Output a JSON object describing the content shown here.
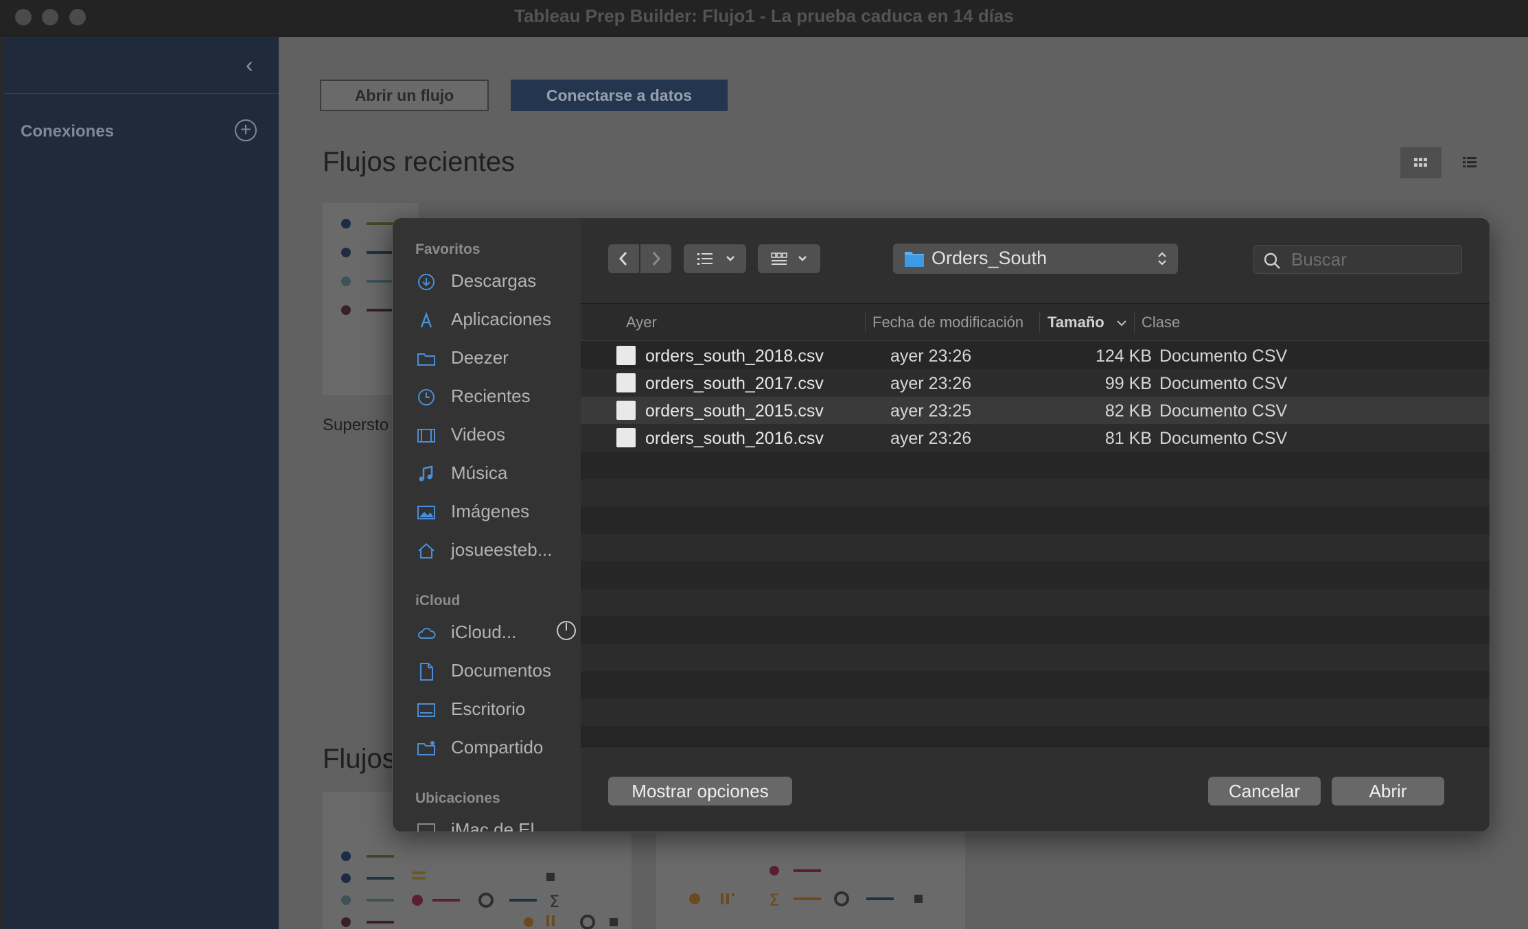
{
  "window": {
    "title": "Tableau Prep Builder: Flujo1 - La prueba caduca en 14 días"
  },
  "left_panel": {
    "connections_label": "Conexiones"
  },
  "start_page": {
    "open_flow_button": "Abrir un flujo",
    "connect_button": "Conectarse a datos",
    "recent_flows_heading": "Flujos recientes",
    "recent_card_label": "Supersto",
    "flows_heading": "Flujos"
  },
  "dialog": {
    "sidebar": {
      "favorites_label": "Favoritos",
      "favorites": [
        "Descargas",
        "Aplicaciones",
        "Deezer",
        "Recientes",
        "Videos",
        "Música",
        "Imágenes",
        "josueesteb..."
      ],
      "icloud_label": "iCloud",
      "icloud": [
        "iCloud...",
        "Documentos",
        "Escritorio",
        "Compartido"
      ],
      "locations_label": "Ubicaciones",
      "locations": [
        "iMac de El..."
      ]
    },
    "toolbar": {
      "current_folder": "Orders_South",
      "search_placeholder": "Buscar"
    },
    "columns": {
      "name": "Ayer",
      "modified": "Fecha de modificación",
      "size": "Tamaño",
      "kind": "Clase"
    },
    "files": [
      {
        "name": "orders_south_2018.csv",
        "modified": "ayer 23:26",
        "size": "124 KB",
        "kind": "Documento CSV"
      },
      {
        "name": "orders_south_2017.csv",
        "modified": "ayer 23:26",
        "size": "99 KB",
        "kind": "Documento CSV"
      },
      {
        "name": "orders_south_2015.csv",
        "modified": "ayer 23:25",
        "size": "82 KB",
        "kind": "Documento CSV"
      },
      {
        "name": "orders_south_2016.csv",
        "modified": "ayer 23:26",
        "size": "81 KB",
        "kind": "Documento CSV"
      }
    ],
    "footer": {
      "options_button": "Mostrar opciones",
      "cancel_button": "Cancelar",
      "open_button": "Abrir"
    }
  }
}
